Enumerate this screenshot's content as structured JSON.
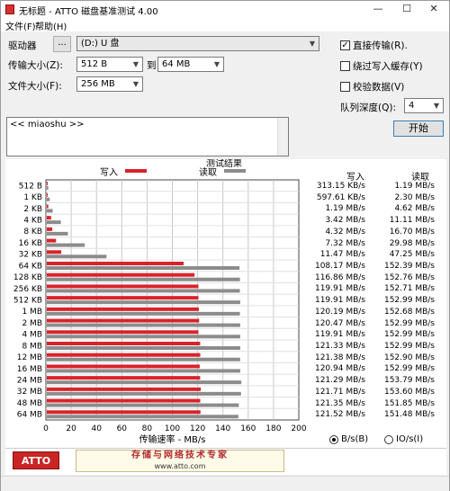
{
  "window": {
    "title": "无标题 - ATTO 磁盘基准测试 4.00",
    "minimize": "—",
    "maximize": "☐",
    "close": "✕"
  },
  "menu": {
    "file": "文件(F)",
    "help": "帮助(H)"
  },
  "controls": {
    "drive_label": "驱动器",
    "browse_btn": "...",
    "drive_value": "(D:) U 盘",
    "transfer_label": "传输大小(Z):",
    "transfer_from": "512 B",
    "to_label": "到",
    "transfer_to": "64 MB",
    "file_size_label": "文件大小(F):",
    "file_size": "256 MB",
    "direct_io": "直接传输(R).",
    "bypass_write_cache": "绕过写入缓存(Y)",
    "verify_data": "校验数据(V)",
    "queue_depth_label": "队列深度(Q):",
    "queue_depth": "4",
    "start_btn": "开始",
    "description": "<< miaoshu >>",
    "direct_io_checked": true,
    "bypass_checked": false,
    "verify_checked": false
  },
  "results": {
    "title": "测试结果",
    "legend_write": "写入",
    "legend_read": "读取",
    "col_write": "写入",
    "col_read": "读取",
    "xlabel": "传输速率 - MB/s",
    "write_color": "#d8232a",
    "read_color": "#8c8c8c",
    "rows": [
      {
        "size": "512 B",
        "write": "313.15 KB/s",
        "read": "1.19 MB/s"
      },
      {
        "size": "1 KB",
        "write": "597.61 KB/s",
        "read": "2.30 MB/s"
      },
      {
        "size": "2 KB",
        "write": "1.19 MB/s",
        "read": "4.62 MB/s"
      },
      {
        "size": "4 KB",
        "write": "3.42 MB/s",
        "read": "11.11 MB/s"
      },
      {
        "size": "8 KB",
        "write": "4.32 MB/s",
        "read": "16.70 MB/s"
      },
      {
        "size": "16 KB",
        "write": "7.32 MB/s",
        "read": "29.98 MB/s"
      },
      {
        "size": "32 KB",
        "write": "11.47 MB/s",
        "read": "47.25 MB/s"
      },
      {
        "size": "64 KB",
        "write": "108.17 MB/s",
        "read": "152.39 MB/s"
      },
      {
        "size": "128 KB",
        "write": "116.86 MB/s",
        "read": "152.76 MB/s"
      },
      {
        "size": "256 KB",
        "write": "119.91 MB/s",
        "read": "152.71 MB/s"
      },
      {
        "size": "512 KB",
        "write": "119.91 MB/s",
        "read": "152.99 MB/s"
      },
      {
        "size": "1 MB",
        "write": "120.19 MB/s",
        "read": "152.68 MB/s"
      },
      {
        "size": "2 MB",
        "write": "120.47 MB/s",
        "read": "152.99 MB/s"
      },
      {
        "size": "4 MB",
        "write": "119.91 MB/s",
        "read": "152.99 MB/s"
      },
      {
        "size": "8 MB",
        "write": "121.33 MB/s",
        "read": "152.99 MB/s"
      },
      {
        "size": "12 MB",
        "write": "121.38 MB/s",
        "read": "152.90 MB/s"
      },
      {
        "size": "16 MB",
        "write": "120.94 MB/s",
        "read": "152.99 MB/s"
      },
      {
        "size": "24 MB",
        "write": "121.29 MB/s",
        "read": "153.79 MB/s"
      },
      {
        "size": "32 MB",
        "write": "121.71 MB/s",
        "read": "153.60 MB/s"
      },
      {
        "size": "48 MB",
        "write": "121.35 MB/s",
        "read": "151.85 MB/s"
      },
      {
        "size": "64 MB",
        "write": "121.52 MB/s",
        "read": "151.48 MB/s"
      }
    ],
    "unit_bytes": "B/s(B)",
    "unit_io": "IO/s(I)",
    "unit_bytes_selected": true
  },
  "chart_data": {
    "type": "bar",
    "title": "测试结果",
    "xlabel": "传输速率 - MB/s",
    "xlim": [
      0,
      200
    ],
    "xticks": [
      "0",
      "20",
      "40",
      "60",
      "80",
      "100",
      "120",
      "140",
      "160",
      "180",
      "200"
    ],
    "categories": [
      "512 B",
      "1 KB",
      "2 KB",
      "4 KB",
      "8 KB",
      "16 KB",
      "32 KB",
      "64 KB",
      "128 KB",
      "256 KB",
      "512 KB",
      "1 MB",
      "2 MB",
      "4 MB",
      "8 MB",
      "12 MB",
      "16 MB",
      "24 MB",
      "32 MB",
      "48 MB",
      "64 MB"
    ],
    "series": [
      {
        "name": "写入",
        "values": [
          0.31,
          0.58,
          1.19,
          3.42,
          4.32,
          7.32,
          11.47,
          108.17,
          116.86,
          119.91,
          119.91,
          120.19,
          120.47,
          119.91,
          121.33,
          121.38,
          120.94,
          121.29,
          121.71,
          121.35,
          121.52
        ]
      },
      {
        "name": "读取",
        "values": [
          1.19,
          2.3,
          4.62,
          11.11,
          16.7,
          29.98,
          47.25,
          152.39,
          152.76,
          152.71,
          152.99,
          152.68,
          152.99,
          152.99,
          152.99,
          152.9,
          152.99,
          153.79,
          153.6,
          151.85,
          151.48
        ]
      }
    ],
    "grid": true,
    "legend": "top"
  },
  "footer": {
    "logo": "ATTO",
    "slogan": "存储与网络技术专家",
    "url": "www.atto.com"
  }
}
